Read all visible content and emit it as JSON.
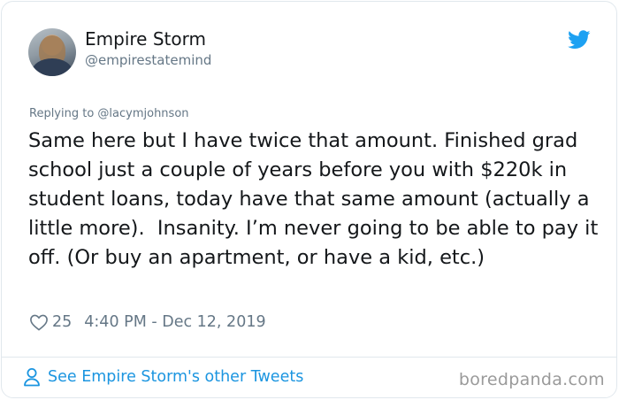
{
  "tweet": {
    "author_name": "Empire Storm",
    "author_handle": "@empirestatemind",
    "replying_to": "Replying to @lacymjohnson",
    "text": "Same here but I have twice that amount. Finished grad school just a couple of years before you with $220k in student loans, today have that same amount (actually a little more).  Insanity. I’m never going to be able to pay it off. (Or buy an apartment, or have a kid, etc.)",
    "likes": "25",
    "timestamp": "4:40 PM - Dec 12, 2019"
  },
  "footer": {
    "see_more_label": "See Empire Storm's other Tweets",
    "watermark": "boredpanda.com"
  },
  "icons": {
    "platform": "twitter-bird-icon",
    "like": "heart-icon",
    "profile": "person-icon"
  },
  "colors": {
    "brand_blue": "#1da1f2",
    "link_blue": "#1b95e0",
    "secondary_text": "#657786",
    "primary_text": "#14171a",
    "border": "#e1e8ed"
  }
}
